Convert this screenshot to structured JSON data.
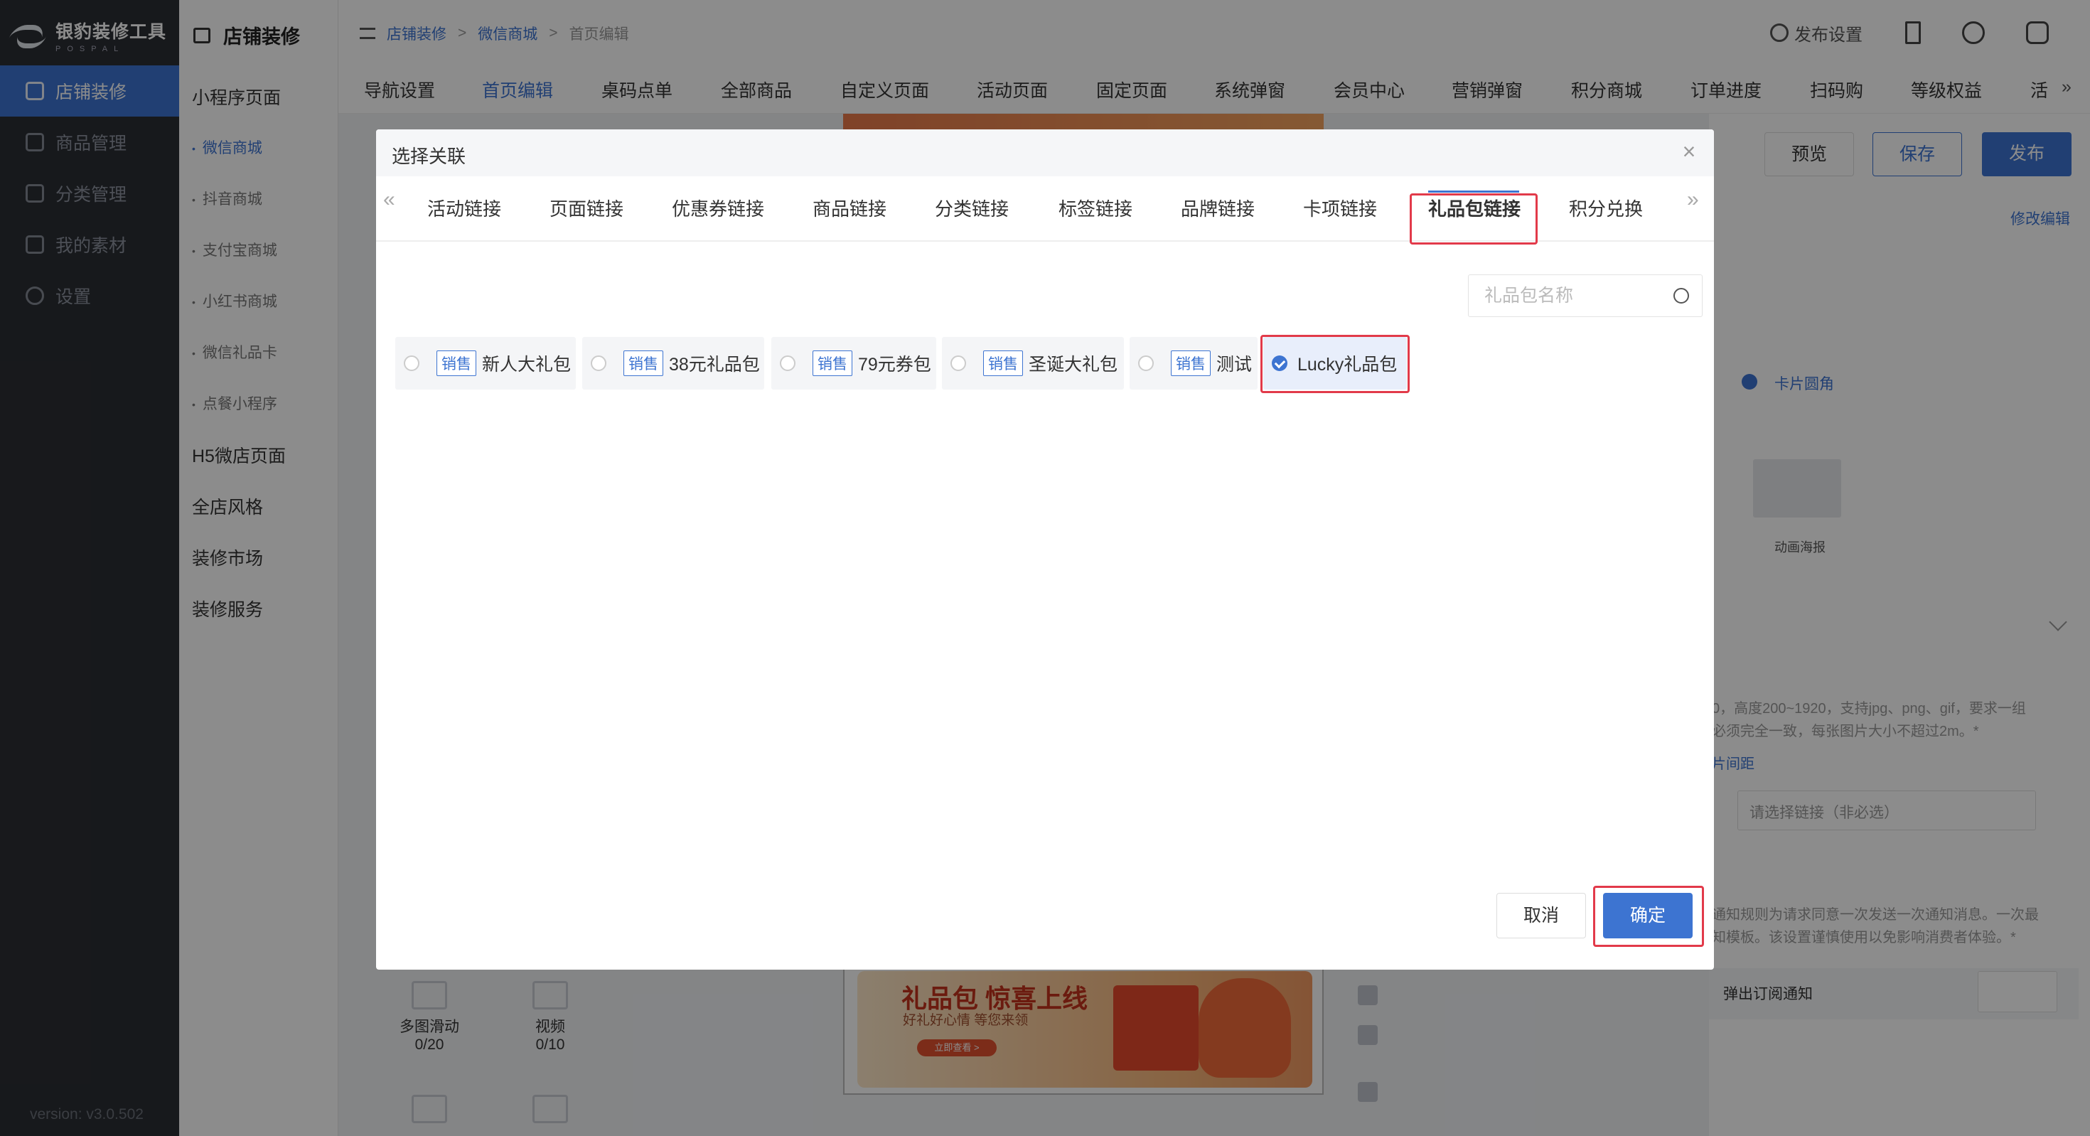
{
  "sidebar": {
    "logo_title": "银豹装修工具",
    "logo_sub": "POSPAL",
    "items": [
      {
        "label": "店铺装修"
      },
      {
        "label": "商品管理"
      },
      {
        "label": "分类管理"
      },
      {
        "label": "我的素材"
      },
      {
        "label": "设置"
      }
    ],
    "version": "version: v3.0.502"
  },
  "col2": {
    "title": "店铺装修",
    "items": [
      {
        "label": "小程序页面"
      },
      {
        "label": "微信商城"
      },
      {
        "label": "抖音商城"
      },
      {
        "label": "支付宝商城"
      },
      {
        "label": "小红书商城"
      },
      {
        "label": "微信礼品卡"
      },
      {
        "label": "点餐小程序"
      },
      {
        "label": "H5微店页面"
      },
      {
        "label": "全店风格"
      },
      {
        "label": "装修市场"
      },
      {
        "label": "装修服务"
      }
    ]
  },
  "header": {
    "breadcrumb": [
      "店铺装修",
      "微信商城",
      "首页编辑"
    ],
    "sep": ">",
    "publish_settings": "发布设置"
  },
  "tabs": [
    "导航设置",
    "首页编辑",
    "桌码点单",
    "全部商品",
    "自定义页面",
    "活动页面",
    "固定页面",
    "系统弹窗",
    "会员中心",
    "营销弹窗",
    "积分商城",
    "订单进度",
    "扫码购",
    "等级权益",
    "活"
  ],
  "toolbar": {
    "preview": "预览",
    "save": "保存",
    "publish": "发布"
  },
  "background": {
    "banner_title": "礼品包 惊喜上线",
    "banner_sub": "好礼好心情 等您来领",
    "banner_btn": "立即查看 >",
    "widgets": [
      {
        "label": "多图滑动",
        "count": "0/20"
      },
      {
        "label": "视频",
        "count": "0/10"
      }
    ],
    "right": {
      "edit": "修改编辑",
      "card_corner": "卡片圆角",
      "anim_poster": "动画海报",
      "note1a": "0，高度200~1920，支持jpg、png、gif，要求一组",
      "note1b": "必须完全一致，每张图片大小不超过2m。*",
      "spacing": "片间距",
      "link_placeholder": "请选择链接（非必选）",
      "note2a": "通知规则为请求同意一次发送一次通知消息。一次最",
      "note2b": "知模板。该设置谨慎使用以免影响消费者体验。*",
      "subscribe": "弹出订阅通知"
    }
  },
  "modal": {
    "title": "选择关联",
    "close": "×",
    "tabs": [
      "活动链接",
      "页面链接",
      "优惠券链接",
      "商品链接",
      "分类链接",
      "标签链接",
      "品牌链接",
      "卡项链接",
      "礼品包链接",
      "积分兑换"
    ],
    "selected_tab": "礼品包链接",
    "search_placeholder": "礼品包名称",
    "options": [
      {
        "tag": "销售",
        "name": "新人大礼包",
        "checked": false
      },
      {
        "tag": "销售",
        "name": "38元礼品包",
        "checked": false
      },
      {
        "tag": "销售",
        "name": "79元券包",
        "checked": false
      },
      {
        "tag": "销售",
        "name": "圣诞大礼包",
        "checked": false
      },
      {
        "tag": "销售",
        "name": "测试",
        "checked": false
      },
      {
        "tag": "",
        "name": "Lucky礼品包",
        "checked": true
      }
    ],
    "cancel": "取消",
    "confirm": "确定"
  },
  "colors": {
    "accent": "#3d74d1",
    "highlight": "#e23a4a",
    "sidebar": "#2b2e33"
  }
}
